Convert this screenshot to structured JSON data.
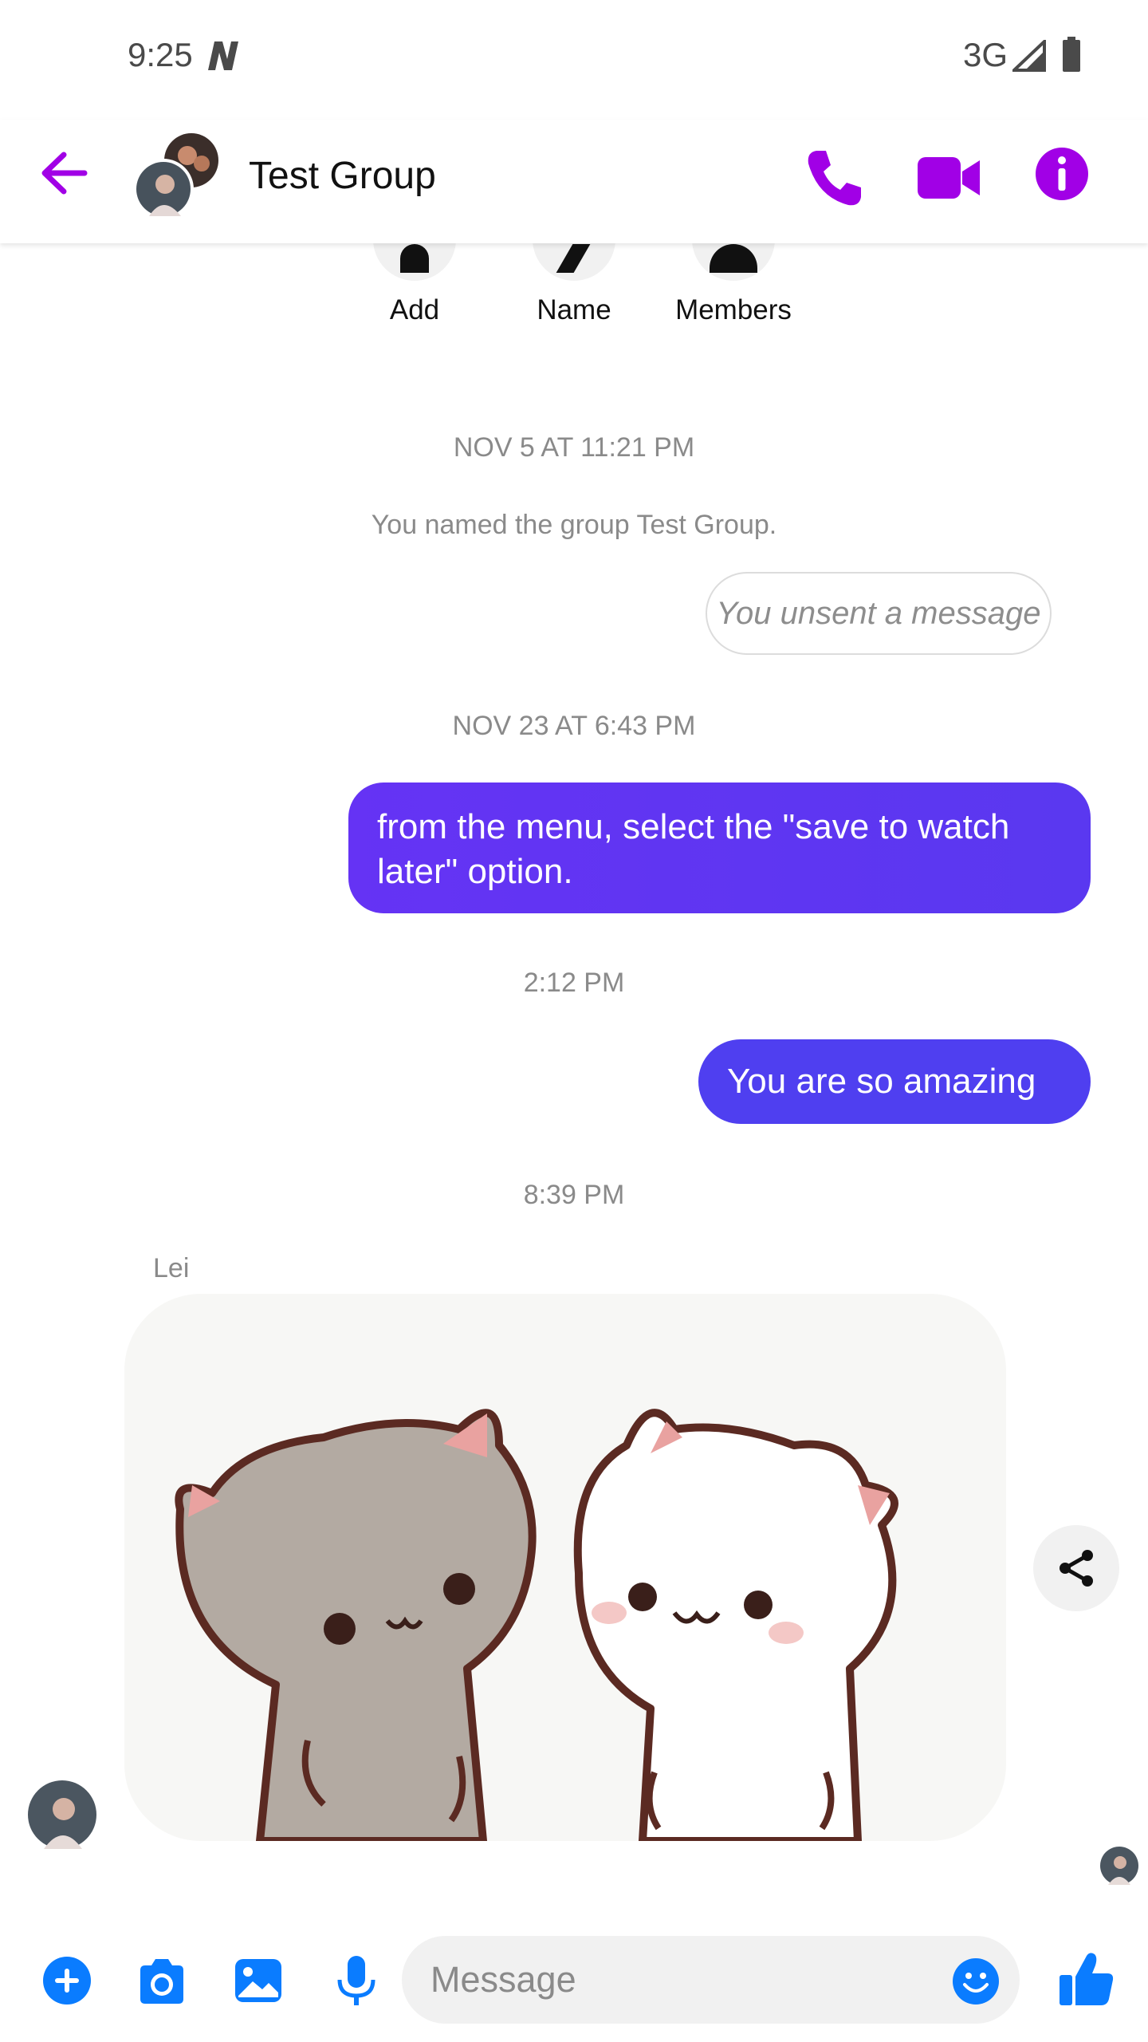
{
  "status_bar": {
    "time": "9:25",
    "network": "3G",
    "notification_icon": "n-icon",
    "signal_icon": "signal-icon",
    "battery_icon": "battery-icon"
  },
  "header": {
    "title": "Test Group",
    "back_icon": "arrow-left-icon",
    "call_icon": "phone-icon",
    "video_icon": "video-camera-icon",
    "info_icon": "info-icon",
    "accent_color": "#a100e6"
  },
  "shortcuts": [
    {
      "label": "Add",
      "icon": "add-person-icon"
    },
    {
      "label": "Name",
      "icon": "pencil-icon"
    },
    {
      "label": "Members",
      "icon": "people-icon"
    }
  ],
  "conversation": {
    "ts1": "NOV 5 AT 11:21 PM",
    "system_msg": "You named the group Test Group.",
    "unsent_msg": "You unsent a message",
    "ts2": "NOV 23 AT 6:43 PM",
    "msg1": "from the menu, select the \"save to watch later\" option.",
    "ts3": "2:12 PM",
    "msg2": "You are so amazing",
    "ts4": "8:39 PM",
    "sender": "Lei",
    "sticker": "two-cats-sticker",
    "bubble_color": "#5b37f2"
  },
  "composer": {
    "placeholder": "Message",
    "icons": [
      "plus-icon",
      "camera-icon",
      "image-icon",
      "microphone-icon",
      "emoji-icon",
      "thumbs-up-icon"
    ],
    "icon_color": "#0a7cff"
  }
}
